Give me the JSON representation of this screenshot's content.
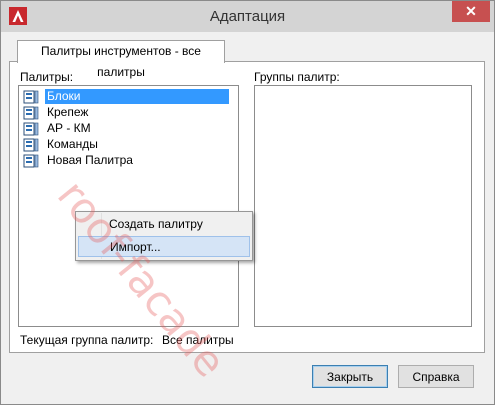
{
  "window": {
    "title": "Адаптация",
    "close_glyph": "✕"
  },
  "tab": {
    "label": "Палитры инструментов - все палитры"
  },
  "palettes": {
    "label": "Палитры:",
    "items": [
      {
        "label": "Блоки",
        "selected": true
      },
      {
        "label": "Крепеж",
        "selected": false
      },
      {
        "label": "АР - КМ",
        "selected": false
      },
      {
        "label": "Команды",
        "selected": false
      },
      {
        "label": "Новая Палитра",
        "selected": false
      }
    ],
    "item_icon": "palette-icon"
  },
  "groups": {
    "label": "Группы палитр:"
  },
  "context_menu": {
    "items": [
      {
        "label": "Создать палитру",
        "hover": false
      },
      {
        "label": "Импорт...",
        "hover": true
      }
    ]
  },
  "current_group": {
    "label": "Текущая группа палитр:",
    "value": "Все палитры"
  },
  "buttons": {
    "close": "Закрыть",
    "help": "Справка"
  },
  "watermark": {
    "text": "roof-facade"
  },
  "colors": {
    "selection": "#3399ff",
    "close_button": "#c75050",
    "menu_hover": "#d5e4f6",
    "app_icon": "#c8282d"
  }
}
